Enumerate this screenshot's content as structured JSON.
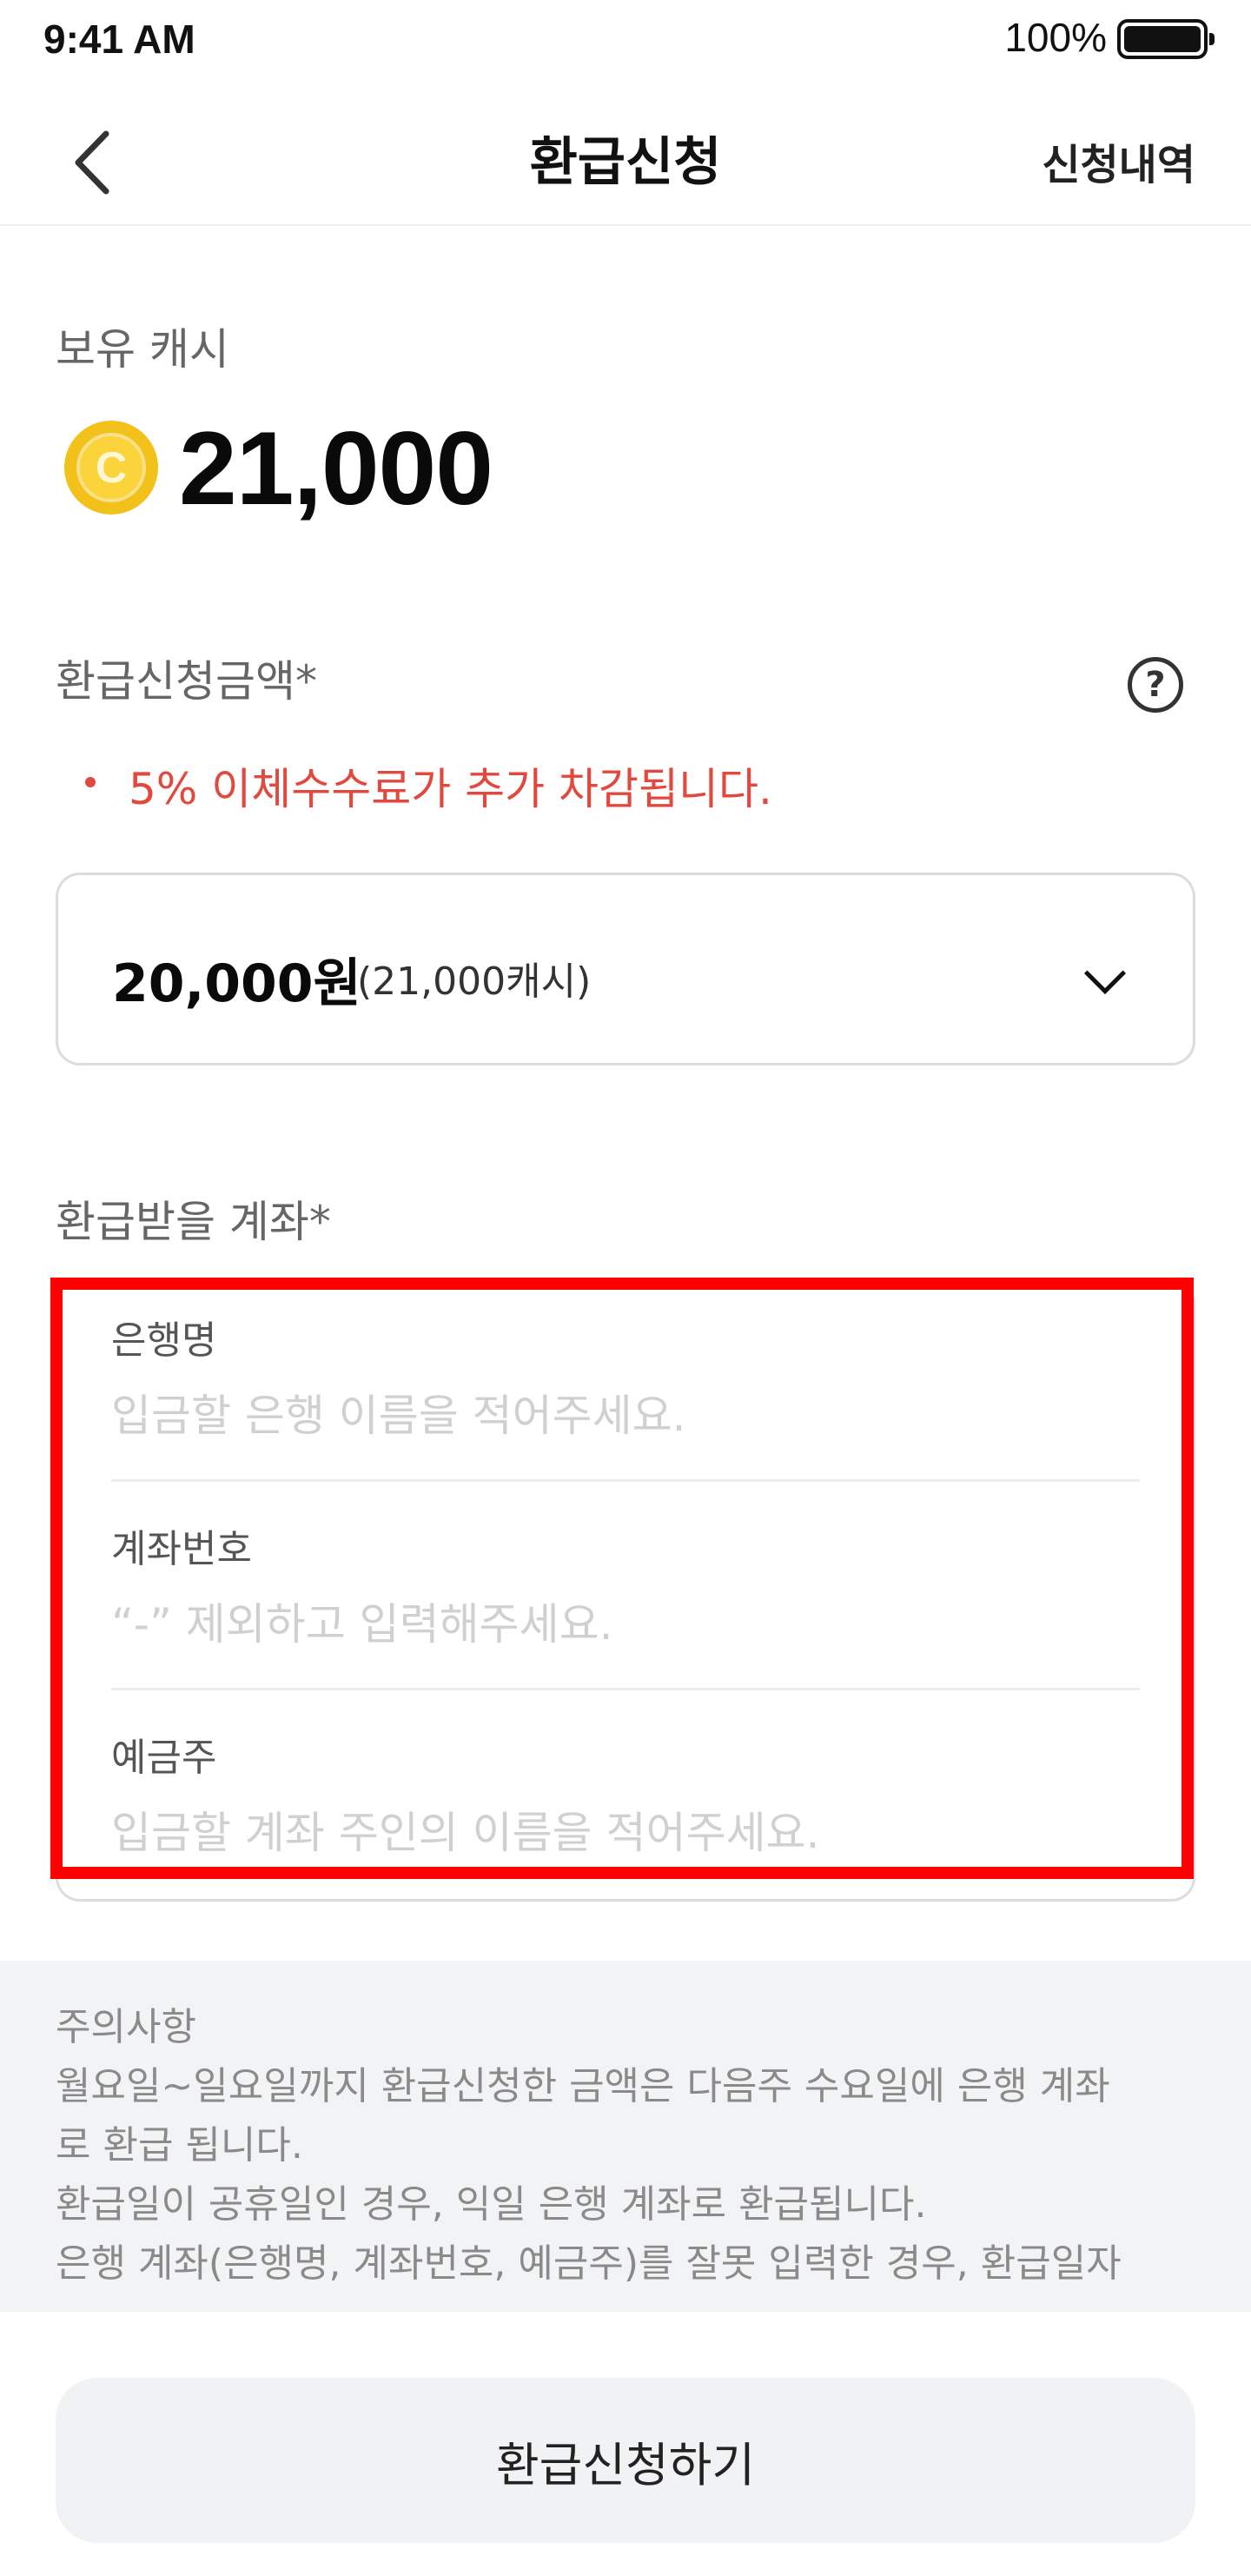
{
  "status_bar": {
    "time": "9:41 AM",
    "battery": "100%"
  },
  "nav": {
    "title": "환급신청",
    "history_link": "신청내역"
  },
  "balance": {
    "label": "보유 캐시",
    "coin_symbol": "C",
    "value": "21,000"
  },
  "amount": {
    "label": "환급신청금액*",
    "fee_note": "5% 이체수수료가 추가 차감됩니다.",
    "selected_main": "20,000원",
    "selected_sub": "(21,000캐시)"
  },
  "account": {
    "label": "환급받을 계좌*",
    "fields": [
      {
        "label": "은행명",
        "placeholder": "입금할 은행 이름을 적어주세요."
      },
      {
        "label": "계좌번호",
        "placeholder": "“-” 제외하고 입력해주세요."
      },
      {
        "label": "예금주",
        "placeholder": "입금할 계좌 주인의 이름을 적어주세요."
      }
    ]
  },
  "notice": {
    "title": "주의사항",
    "lines": [
      "월요일~일요일까지 환급신청한 금액은 다음주 수요일에 은행 계좌",
      "로 환급 됩니다.",
      "환급일이 공휴일인 경우, 익일 은행 계좌로 환급됩니다.",
      "은행 계좌(은행명, 계좌번호, 예금주)를 잘못 입력한 경우, 환급일자"
    ]
  },
  "submit_label": "환급신청하기"
}
